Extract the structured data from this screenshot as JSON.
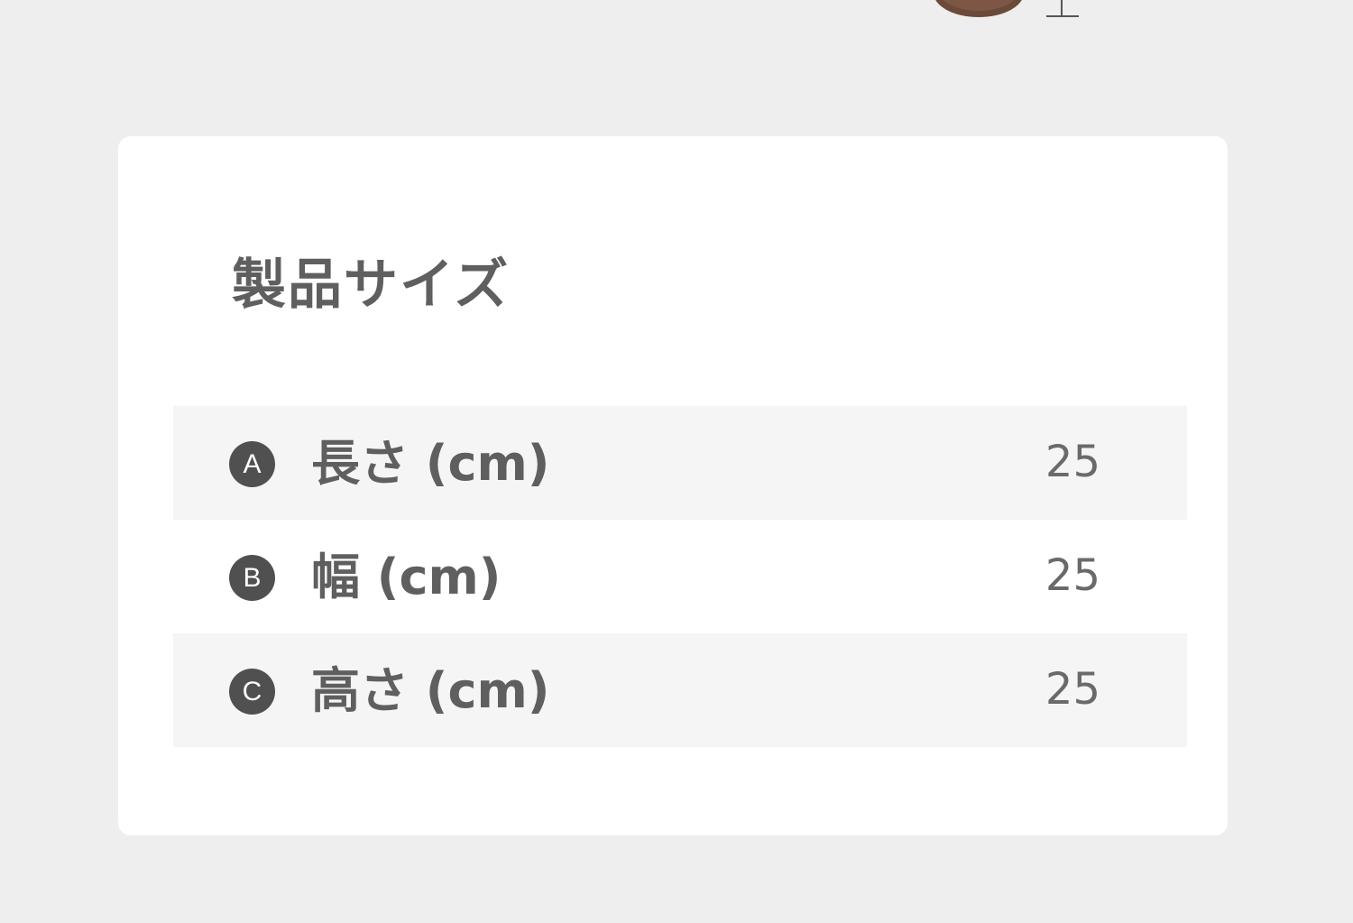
{
  "product_size": {
    "title": "製品サイズ",
    "rows": [
      {
        "badge": "A",
        "label": "長さ (cm)",
        "value": "25"
      },
      {
        "badge": "B",
        "label": "幅 (cm)",
        "value": "25"
      },
      {
        "badge": "C",
        "label": "高さ (cm)",
        "value": "25"
      }
    ]
  },
  "colors": {
    "background": "#efeeee",
    "card": "#ffffff",
    "shaded_row": "#f6f5f5",
    "badge": "#505050",
    "text": "#5f5f5f"
  }
}
